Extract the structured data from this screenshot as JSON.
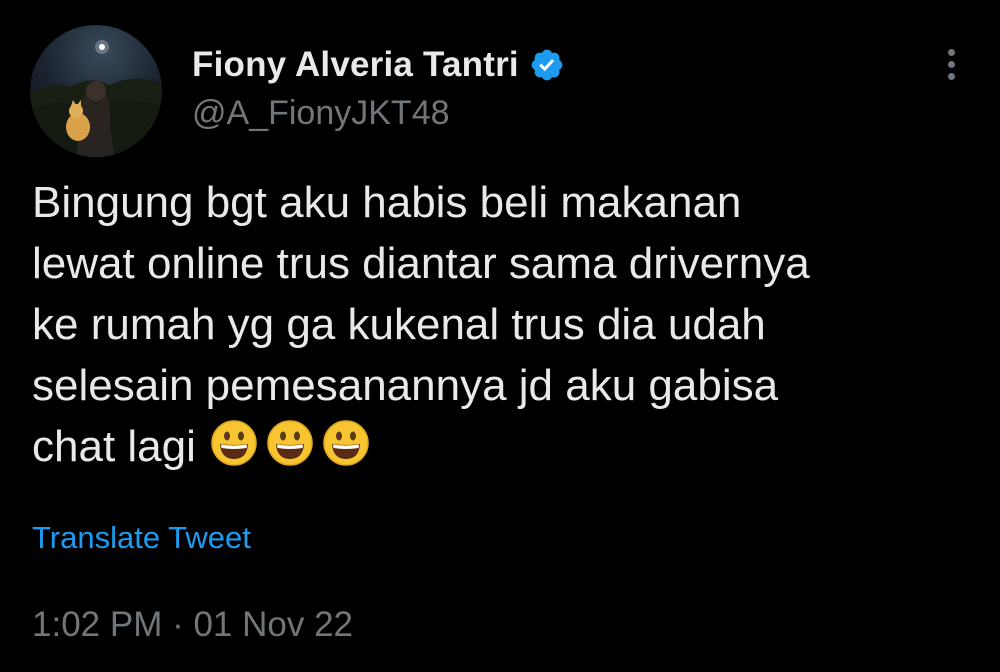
{
  "tweet": {
    "author": {
      "display_name": "Fiony Alveria Tantri",
      "handle": "@A_FionyJKT48",
      "verified": true,
      "avatar_icon": "profile-photo-night-sky"
    },
    "text_lines": [
      "Bingung bgt aku habis beli makanan",
      "lewat online trus diantar sama drivernya",
      "ke rumah yg ga kukenal trus dia udah",
      "selesain pemesanannya jd aku gabisa",
      "chat lagi"
    ],
    "emojis": [
      "grinning-face-icon",
      "grinning-face-icon",
      "grinning-face-icon"
    ],
    "translate_label": "Translate Tweet",
    "timestamp": "1:02 PM · 01 Nov 22"
  },
  "colors": {
    "background": "#000000",
    "primary_text": "#e7e9ea",
    "secondary_text": "#71767b",
    "accent": "#1d9bf0"
  }
}
